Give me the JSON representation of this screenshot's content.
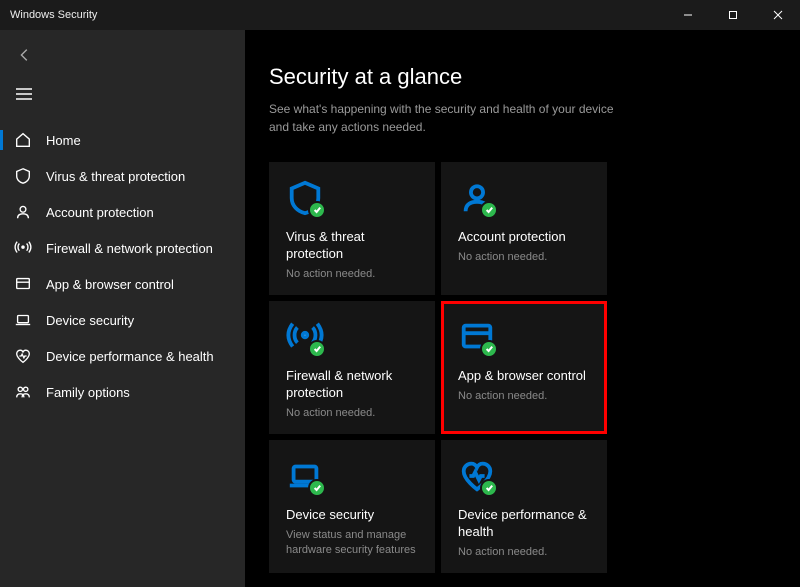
{
  "window_title": "Windows Security",
  "page": {
    "title": "Security at a glance",
    "subtitle": "See what's happening with the security and health of your device and take any actions needed."
  },
  "sidebar": {
    "items": [
      {
        "id": "home",
        "label": "Home",
        "icon": "home-icon",
        "selected": true
      },
      {
        "id": "virus",
        "label": "Virus & threat protection",
        "icon": "shield-icon"
      },
      {
        "id": "account",
        "label": "Account protection",
        "icon": "person-icon"
      },
      {
        "id": "firewall",
        "label": "Firewall & network protection",
        "icon": "antenna-icon"
      },
      {
        "id": "app",
        "label": "App & browser control",
        "icon": "window-icon"
      },
      {
        "id": "device",
        "label": "Device security",
        "icon": "laptop-icon"
      },
      {
        "id": "perf",
        "label": "Device performance & health",
        "icon": "heart-icon"
      },
      {
        "id": "family",
        "label": "Family options",
        "icon": "family-icon"
      }
    ]
  },
  "tiles": [
    {
      "id": "virus",
      "title": "Virus & threat protection",
      "status": "No action needed.",
      "icon": "shield-icon",
      "badge": "ok"
    },
    {
      "id": "account",
      "title": "Account protection",
      "status": "No action needed.",
      "icon": "person-icon",
      "badge": "ok"
    },
    {
      "id": "firewall",
      "title": "Firewall & network protection",
      "status": "No action needed.",
      "icon": "antenna-icon",
      "badge": "ok"
    },
    {
      "id": "app",
      "title": "App & browser control",
      "status": "No action needed.",
      "icon": "window-icon",
      "badge": "ok",
      "highlight": true
    },
    {
      "id": "device",
      "title": "Device security",
      "status": "View status and manage hardware security features",
      "icon": "laptop-icon",
      "badge": "ok"
    },
    {
      "id": "perf",
      "title": "Device performance & health",
      "status": "No action needed.",
      "icon": "heart-icon",
      "badge": "ok"
    }
  ],
  "colors": {
    "accent": "#0078d4",
    "ok_badge": "#2db84d",
    "highlight": "#ff0000"
  }
}
